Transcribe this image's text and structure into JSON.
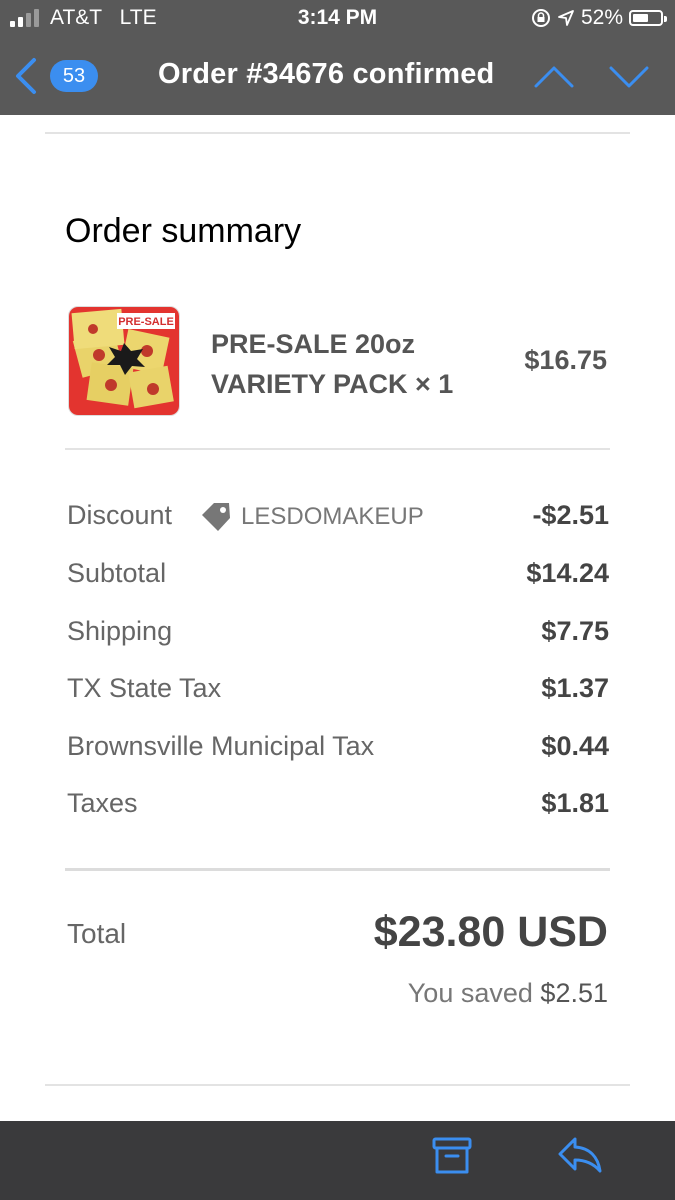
{
  "status_bar": {
    "carrier": "AT&T",
    "network": "LTE",
    "time": "3:14 PM",
    "battery": "52%"
  },
  "nav": {
    "unread_count": "53",
    "title": "Order #34676 confirmed"
  },
  "summary": {
    "heading": "Order summary",
    "product": {
      "image_label": "PRE-SALE",
      "name_line1": "PRE-SALE 20oz",
      "name_line2": "VARIETY PACK × 1",
      "price": "$16.75"
    },
    "discount": {
      "label": "Discount",
      "code": "LESDOMAKEUP",
      "value": "-$2.51"
    },
    "lines": [
      {
        "label": "Subtotal",
        "value": "$14.24"
      },
      {
        "label": "Shipping",
        "value": "$7.75"
      },
      {
        "label": "TX State Tax",
        "value": "$1.37"
      },
      {
        "label": "Brownsville Municipal Tax",
        "value": "$0.44"
      },
      {
        "label": "Taxes",
        "value": "$1.81"
      }
    ],
    "total": {
      "label": "Total",
      "value": "$23.80 USD",
      "saved_prefix": "You saved",
      "saved_amount": "$2.51"
    }
  },
  "icons": {
    "back": "chevron-left-icon",
    "prev": "chevron-up-icon",
    "next": "chevron-down-icon",
    "archive": "archive-icon",
    "reply": "reply-icon",
    "tag": "tag-icon"
  },
  "colors": {
    "header_bg": "#595959",
    "accent_blue": "#3b8ef0",
    "bottom_bar_bg": "#3a3a3c"
  }
}
